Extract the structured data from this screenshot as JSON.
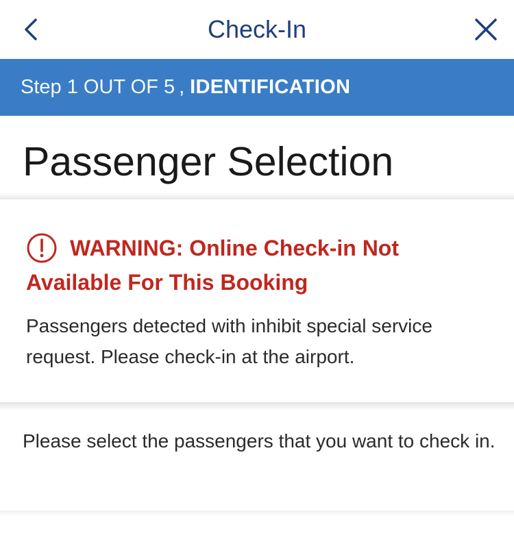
{
  "header": {
    "title": "Check-In",
    "back_icon": "chevron-left-icon",
    "close_icon": "close-icon",
    "accent_color": "#1f3f7a"
  },
  "step_bar": {
    "prefix": "Step 1 OUT OF 5",
    "separator": ",",
    "step_name": "IDENTIFICATION",
    "background_color": "#3a7dc6"
  },
  "page": {
    "title": "Passenger Selection"
  },
  "warning": {
    "icon": "alert-circle-icon",
    "title": "WARNING: Online Check-in Not Available For This Booking",
    "message": "Passengers detected with inhibit special service request. Please check-in at the airport.",
    "color": "#c0271f"
  },
  "instruction": {
    "text": "Please select the passengers that you want to check in."
  }
}
